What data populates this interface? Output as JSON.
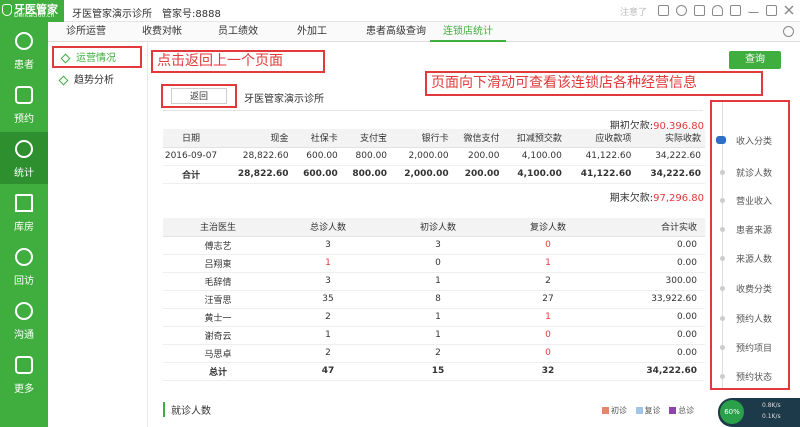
{
  "app": {
    "logo_text": "牙医管家",
    "logo_sub": "Dental360.cn",
    "clinic_name": "牙医管家演示诊所",
    "account": "管家号:8888",
    "user_label": "注意了"
  },
  "nav": {
    "tabs": [
      "诊所运营",
      "收费对帐",
      "员工绩效",
      "外加工",
      "患者高级查询",
      "连锁店统计"
    ],
    "active_index": 5
  },
  "sidebar": {
    "items": [
      {
        "label": "患者"
      },
      {
        "label": "预约"
      },
      {
        "label": "统计"
      },
      {
        "label": "库房"
      },
      {
        "label": "回访"
      },
      {
        "label": "沟通"
      },
      {
        "label": "更多"
      }
    ],
    "active_index": 2
  },
  "submenu": {
    "items": [
      {
        "label": "运营情况"
      },
      {
        "label": "趋势分析"
      }
    ]
  },
  "annotations": {
    "back_hint": "点击返回上一个页面",
    "scroll_hint": "页面向下滑动可查看该连锁店各种经营信息"
  },
  "toolbar": {
    "query_label": "查询",
    "back_label": "返回",
    "store_name": "牙医管家演示诊所"
  },
  "finance": {
    "opening_label": "期初欠款:",
    "opening_value": "90,396.80",
    "closing_label": "期末欠款:",
    "closing_value": "97,296.80",
    "headers": [
      "日期",
      "现金",
      "社保卡",
      "支付宝",
      "银行卡",
      "微信支付",
      "扣减预交款",
      "应收款项",
      "实际收款"
    ],
    "rows": [
      [
        "2016-09-07",
        "28,822.60",
        "600.00",
        "800.00",
        "2,000.00",
        "200.00",
        "4,100.00",
        "41,122.60",
        "34,222.60"
      ]
    ],
    "total": [
      "合计",
      "28,822.60",
      "600.00",
      "800.00",
      "2,000.00",
      "200.00",
      "4,100.00",
      "41,122.60",
      "34,222.60"
    ]
  },
  "doctors": {
    "headers": [
      "主治医生",
      "总诊人数",
      "初诊人数",
      "复诊人数",
      "合计实收"
    ],
    "rows": [
      [
        "傅志艺",
        "3",
        "3",
        "0",
        "0.00"
      ],
      [
        "吕翔東",
        "1",
        "0",
        "1",
        "0.00"
      ],
      [
        "毛辞倩",
        "3",
        "1",
        "2",
        "300.00"
      ],
      [
        "汪雪思",
        "35",
        "8",
        "27",
        "33,922.60"
      ],
      [
        "黄士一",
        "2",
        "1",
        "1",
        "0.00"
      ],
      [
        "谢奇云",
        "1",
        "1",
        "0",
        "0.00"
      ],
      [
        "马思卓",
        "2",
        "2",
        "0",
        "0.00"
      ]
    ],
    "total": [
      "总计",
      "47",
      "15",
      "32",
      "34,222.60"
    ]
  },
  "visits": {
    "title": "就诊人数",
    "legend": [
      {
        "label": "初诊",
        "color": "#e8866a"
      },
      {
        "label": "复诊",
        "color": "#9fc5e8"
      },
      {
        "label": "总诊",
        "color": "#8e44ad"
      }
    ]
  },
  "right_nav": {
    "items": [
      "收入分类",
      "就诊人数",
      "营业收入",
      "患者来源",
      "来源人数",
      "收费分类",
      "预约人数",
      "预约项目",
      "预约状态"
    ],
    "active_index": 0
  },
  "widget": {
    "gauge": "60%",
    "up": "0.8K/s",
    "down": "0.1K/s"
  },
  "colors": {
    "brand": "#3fae3f",
    "annotation": "#e03a3a",
    "nav_active": "#2f6ec8"
  }
}
